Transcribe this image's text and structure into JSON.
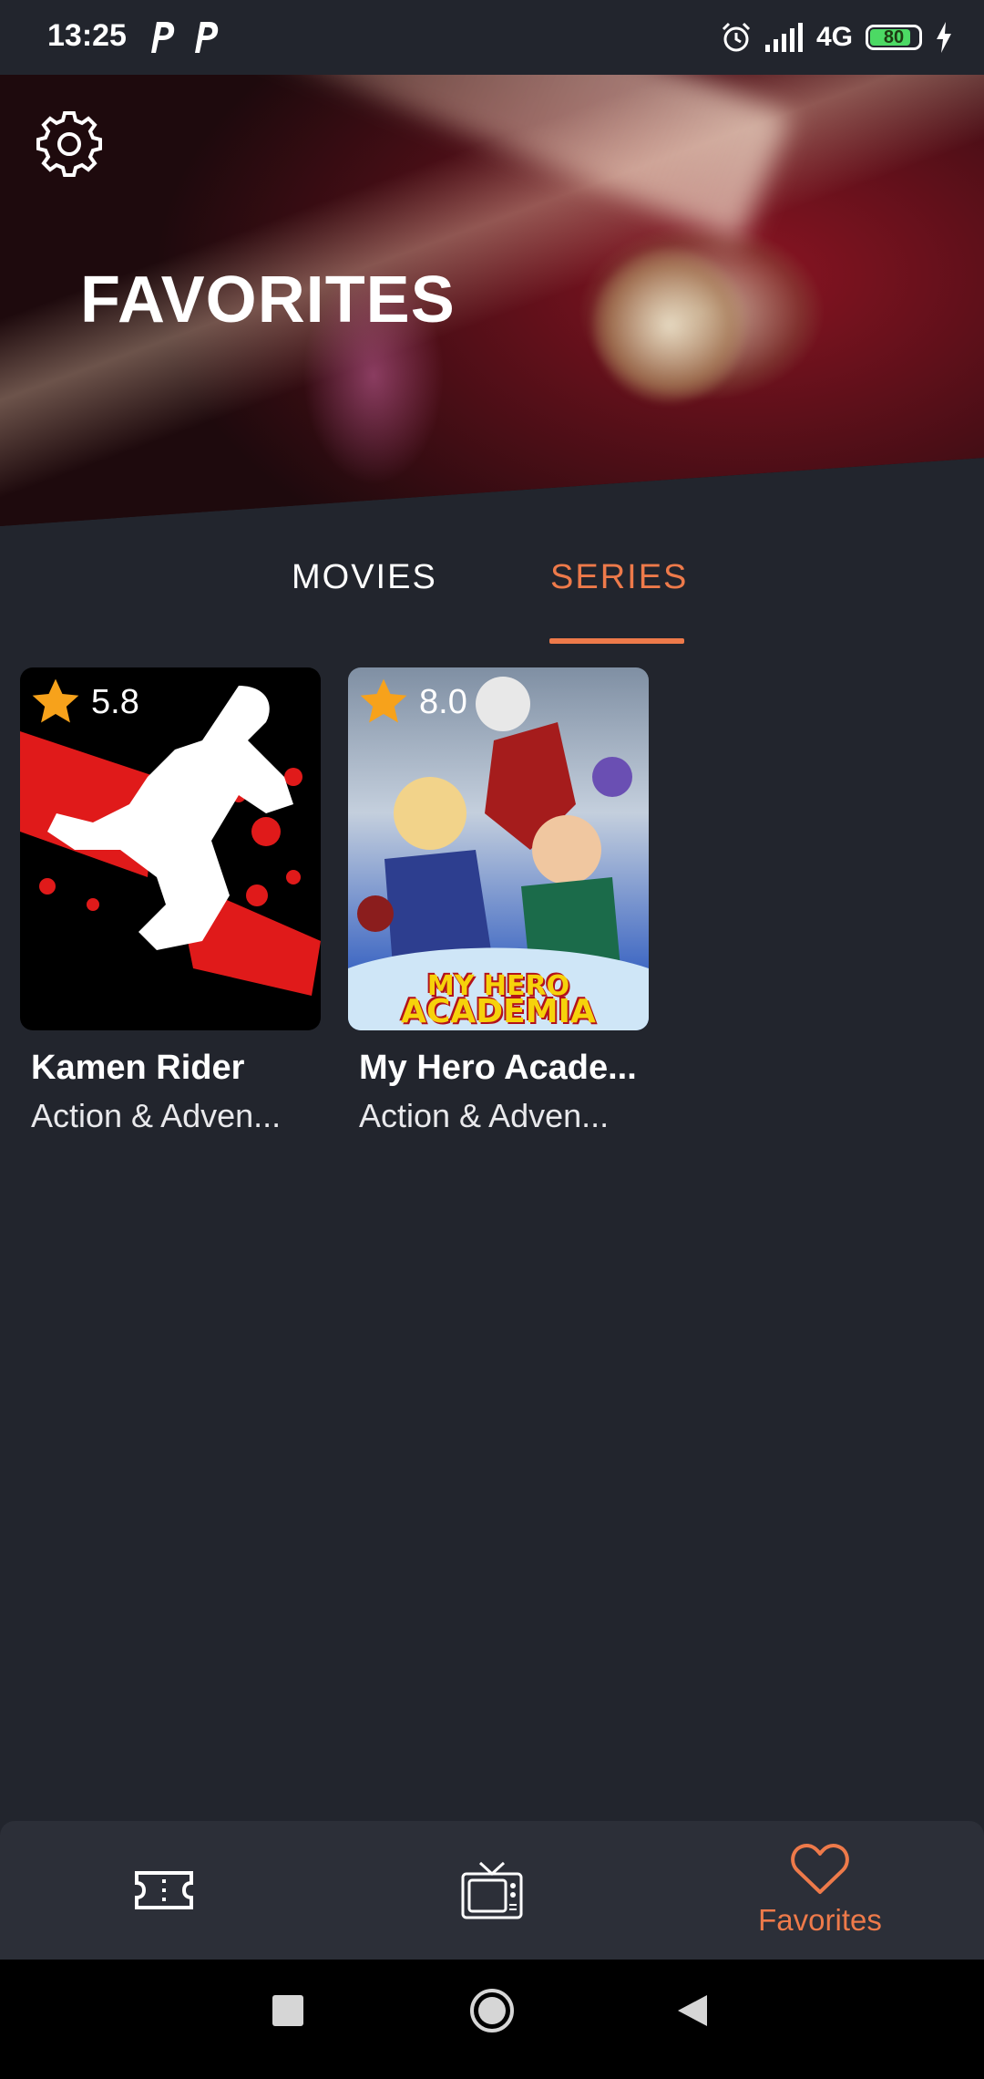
{
  "status_bar": {
    "time": "13:25",
    "network": "4G",
    "battery": "80"
  },
  "header": {
    "title": "FAVORITES",
    "settings_icon": "gear-icon"
  },
  "tabs": [
    {
      "label": "MOVIES",
      "active": false
    },
    {
      "label": "SERIES",
      "active": true
    }
  ],
  "cards": [
    {
      "title": "Kamen Rider",
      "genre": "Action & Adven...",
      "rating": "5.8"
    },
    {
      "title": "My Hero Acade...",
      "genre": "Action & Adven...",
      "rating": "8.0",
      "poster_text_1": "MY HERO",
      "poster_text_2": "ACADEMIA"
    }
  ],
  "bottom_nav": {
    "items": [
      {
        "icon": "ticket-icon",
        "label": ""
      },
      {
        "icon": "tv-icon",
        "label": ""
      },
      {
        "icon": "heart-icon",
        "label": "Favorites",
        "active": true
      }
    ]
  },
  "colors": {
    "background": "#22252d",
    "accent": "#ee7a4a",
    "nav_background": "#2c2f38"
  }
}
